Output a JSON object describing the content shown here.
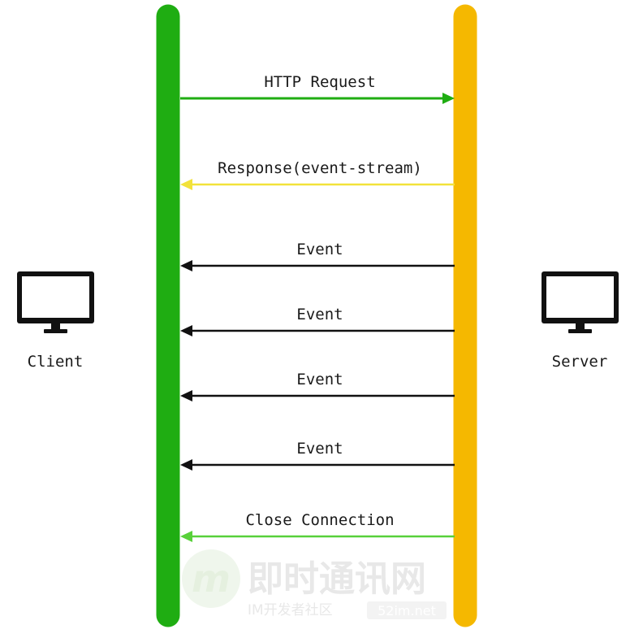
{
  "actors": {
    "client": {
      "label": "Client",
      "icon": "monitor-icon",
      "lifeline_color": "#1fad12"
    },
    "server": {
      "label": "Server",
      "icon": "monitor-icon",
      "lifeline_color": "#f5b800"
    }
  },
  "messages": [
    {
      "label": "HTTP Request",
      "from": "client",
      "to": "server",
      "color": "#1fad12"
    },
    {
      "label": "Response(event-stream)",
      "from": "server",
      "to": "client",
      "color": "#f2e23a"
    },
    {
      "label": "Event",
      "from": "server",
      "to": "client",
      "color": "#111111"
    },
    {
      "label": "Event",
      "from": "server",
      "to": "client",
      "color": "#111111"
    },
    {
      "label": "Event",
      "from": "server",
      "to": "client",
      "color": "#111111"
    },
    {
      "label": "Event",
      "from": "server",
      "to": "client",
      "color": "#111111"
    },
    {
      "label": "Close Connection",
      "from": "server",
      "to": "client",
      "color": "#58d13a"
    }
  ],
  "watermark": {
    "logo_letter": "m",
    "title": "即时通讯网",
    "subtitle": "IM开发者社区",
    "site": "52im.net"
  }
}
